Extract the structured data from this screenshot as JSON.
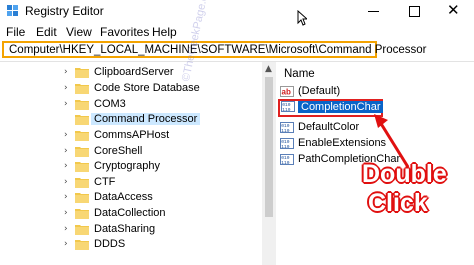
{
  "window": {
    "title": "Registry Editor"
  },
  "menu": [
    "File",
    "Edit",
    "View",
    "Favorites",
    "Help"
  ],
  "address": {
    "path": "Computer\\HKEY_LOCAL_MACHINE\\SOFTWARE\\Microsoft\\Command Processor"
  },
  "tree": {
    "items": [
      {
        "label": "ClipboardServer"
      },
      {
        "label": "Code Store Database"
      },
      {
        "label": "COM3"
      },
      {
        "label": "Command Processor"
      },
      {
        "label": "CommsAPHost"
      },
      {
        "label": "CoreShell"
      },
      {
        "label": "Cryptography"
      },
      {
        "label": "CTF"
      },
      {
        "label": "DataAccess"
      },
      {
        "label": "DataCollection"
      },
      {
        "label": "DataSharing"
      },
      {
        "label": "DDDS"
      }
    ]
  },
  "values": {
    "column_header": "Name",
    "items": [
      {
        "label": "(Default)",
        "icon": "string-value-icon"
      },
      {
        "label": "CompletionChar",
        "icon": "binary-value-icon"
      },
      {
        "label": "DefaultColor",
        "icon": "binary-value-icon"
      },
      {
        "label": "EnableExtensions",
        "icon": "binary-value-icon"
      },
      {
        "label": "PathCompletionChar",
        "icon": "binary-value-icon"
      }
    ]
  },
  "annotation": {
    "line1": "Double",
    "line2": "Click"
  },
  "watermark": "©TheGeekPage.com",
  "colors": {
    "address_border": "#f4a300",
    "highlight_border": "#e02020",
    "selection": "#0a64c8",
    "callout": "#e01010"
  }
}
